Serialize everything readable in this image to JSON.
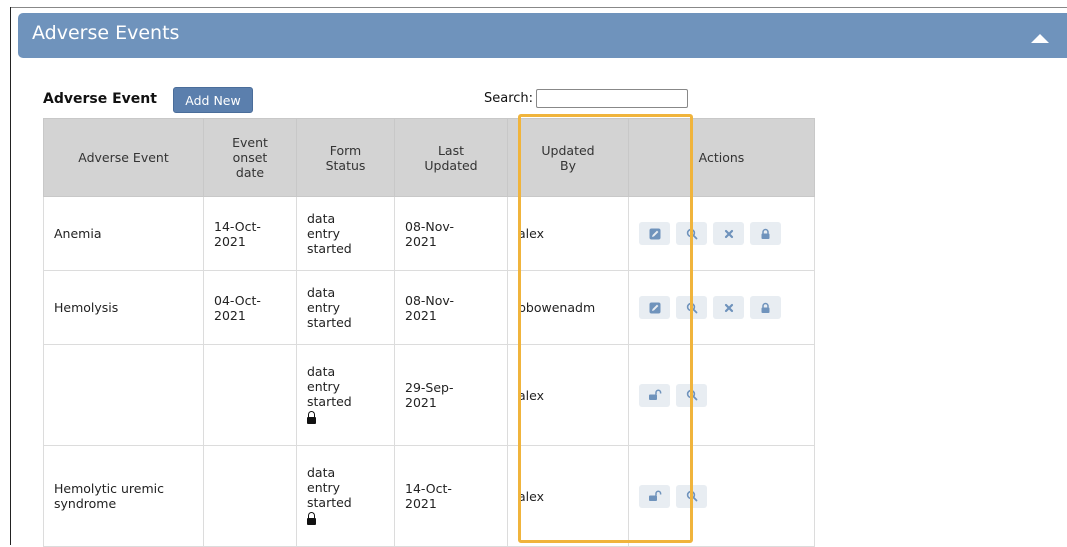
{
  "panel": {
    "title": "Adverse Events"
  },
  "toolbar": {
    "section_label": "Adverse Event",
    "add_new_label": "Add New",
    "search_label": "Search:",
    "search_value": ""
  },
  "table": {
    "headers": [
      {
        "line1": "Adverse Event",
        "line2": "",
        "line3": ""
      },
      {
        "line1": "Event",
        "line2": "onset",
        "line3": "date"
      },
      {
        "line1": "Form",
        "line2": "Status",
        "line3": ""
      },
      {
        "line1": "Last",
        "line2": "Updated",
        "line3": ""
      },
      {
        "line1": "Updated",
        "line2": "By",
        "line3": ""
      },
      {
        "line1": "Actions",
        "line2": "",
        "line3": ""
      }
    ],
    "rows": [
      {
        "event": [
          "Anemia",
          ""
        ],
        "onset": [
          "14-Oct-",
          "2021"
        ],
        "status": [
          "data",
          "entry",
          "started"
        ],
        "status_locked": false,
        "updated": [
          "08-Nov-",
          "2021"
        ],
        "by": "alex",
        "actions": [
          "edit-icon",
          "search-icon",
          "delete-icon",
          "lock-icon"
        ]
      },
      {
        "event": [
          "Hemolysis",
          ""
        ],
        "onset": [
          "04-Oct-",
          "2021"
        ],
        "status": [
          "data",
          "entry",
          "started"
        ],
        "status_locked": false,
        "updated": [
          "08-Nov-",
          "2021"
        ],
        "by": "pbowenadm",
        "actions": [
          "edit-icon",
          "search-icon",
          "delete-icon",
          "lock-icon"
        ]
      },
      {
        "event": [
          "",
          ""
        ],
        "onset": [
          "",
          ""
        ],
        "status": [
          "data",
          "entry",
          "started"
        ],
        "status_locked": true,
        "updated": [
          "29-Sep-",
          "2021"
        ],
        "by": "alex",
        "actions": [
          "unlock-icon",
          "search-icon"
        ]
      },
      {
        "event": [
          "Hemolytic uremic",
          "syndrome"
        ],
        "onset": [
          "",
          ""
        ],
        "status": [
          "data",
          "entry",
          "started"
        ],
        "status_locked": true,
        "updated": [
          "14-Oct-",
          "2021"
        ],
        "by": "alex",
        "actions": [
          "unlock-icon",
          "search-icon"
        ]
      }
    ]
  },
  "colors": {
    "header_bar": "#6f93bc",
    "button": "#5b7fad",
    "table_header": "#d3d3d3",
    "action_button_bg": "#e8edf2",
    "action_icon": "#6f93bc",
    "highlight": "#f0b43c"
  }
}
